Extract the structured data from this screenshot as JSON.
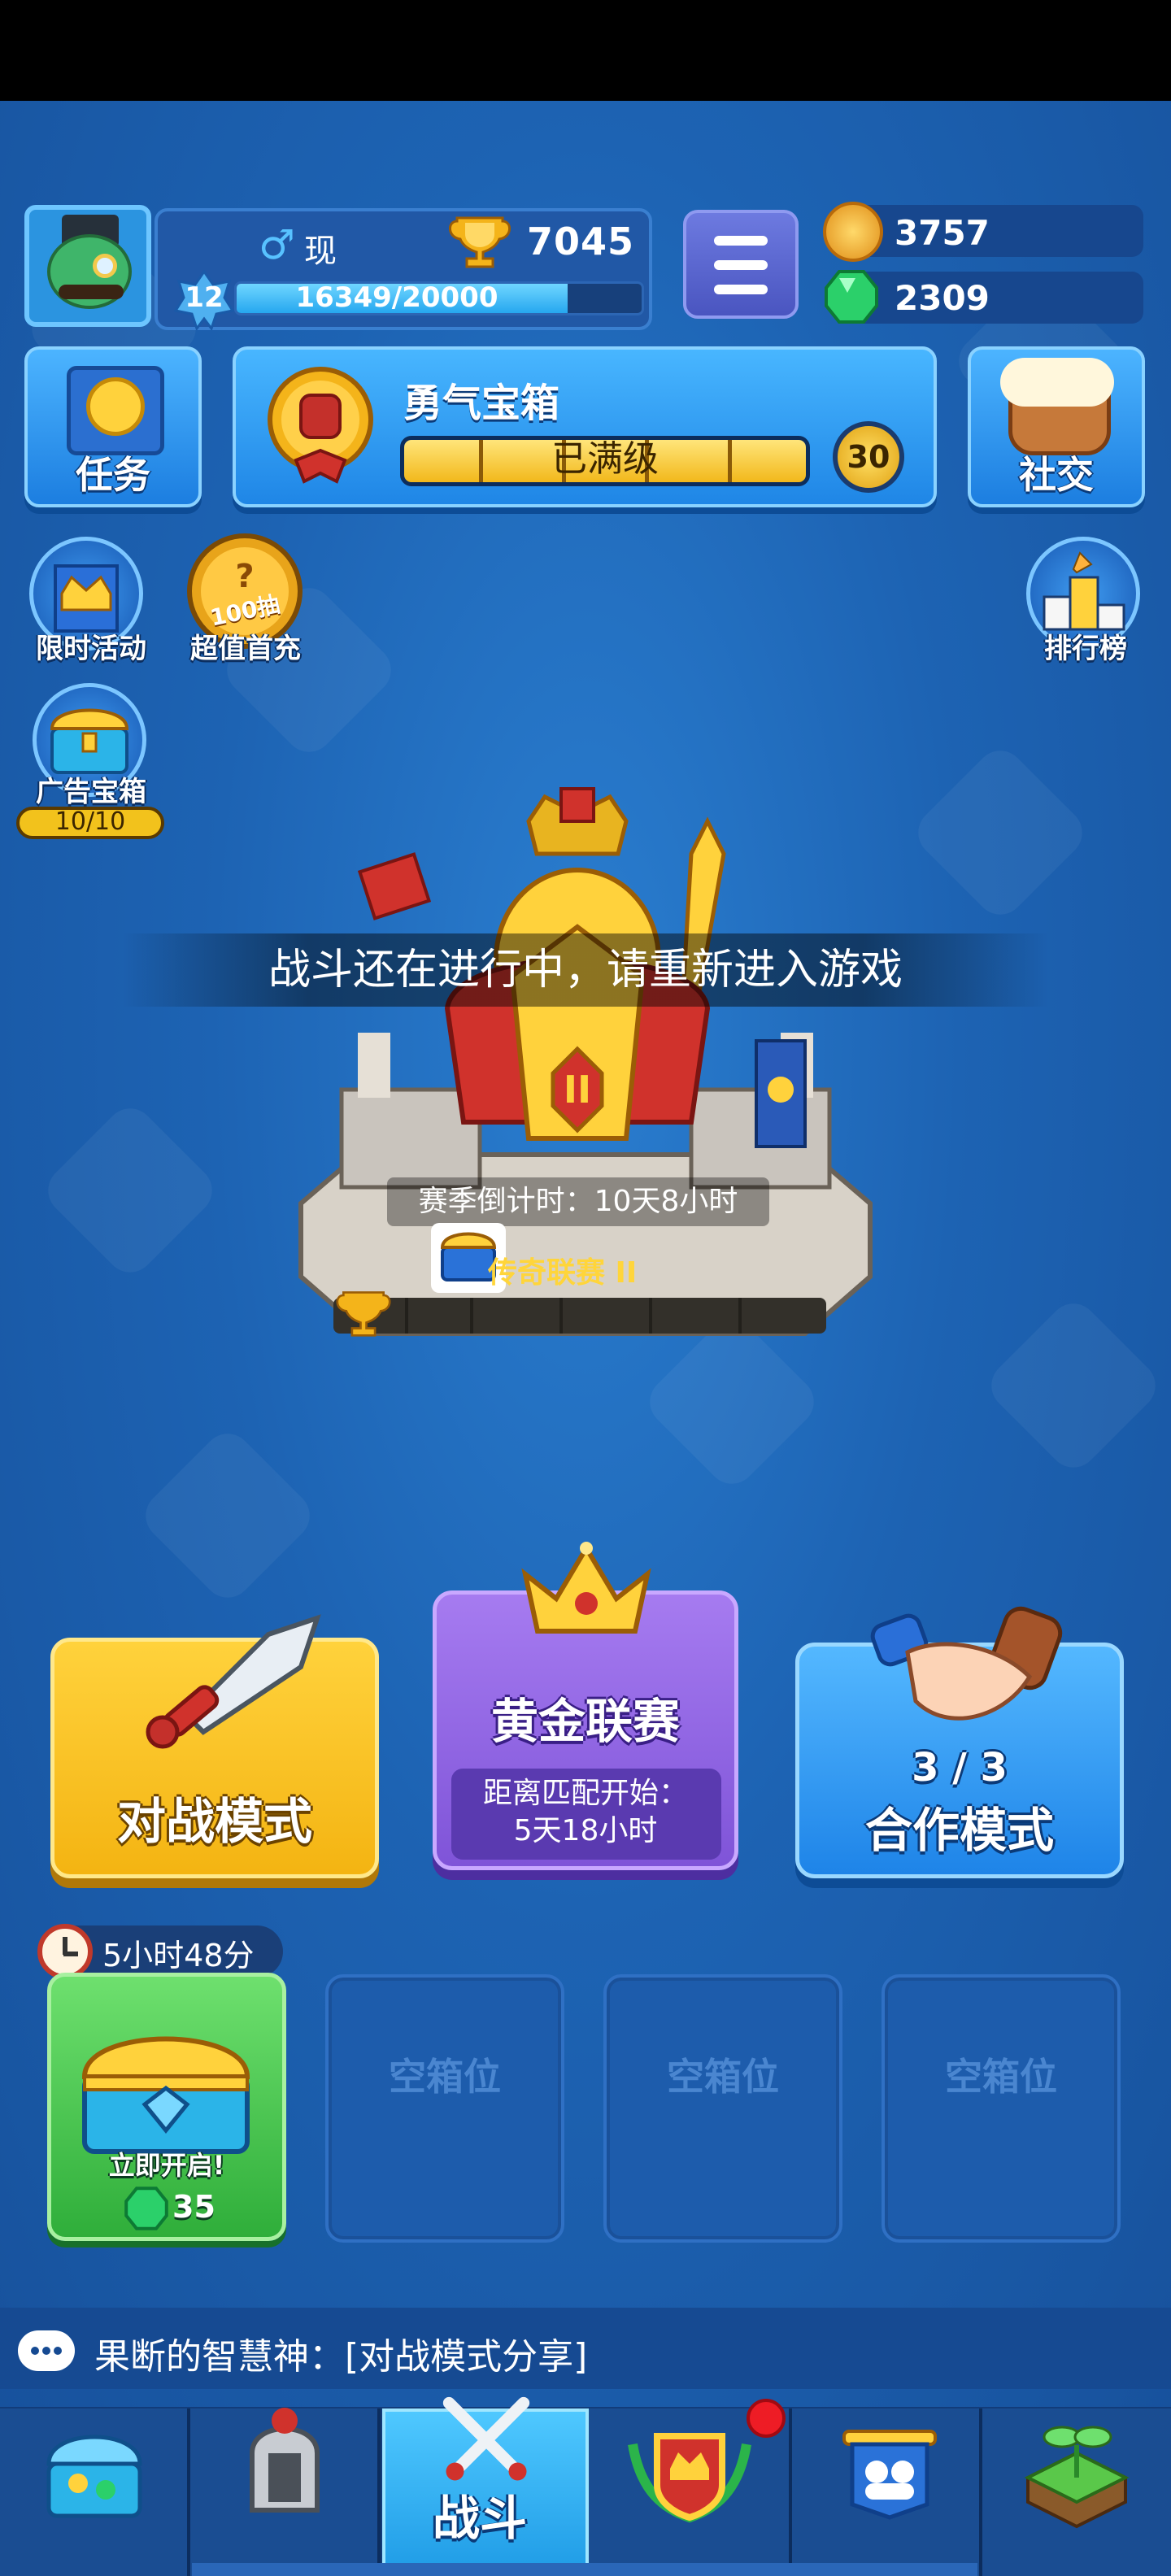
{
  "player": {
    "gender_symbol": "♂",
    "name": "现",
    "trophies": "7045",
    "level": "12",
    "xp_text": "16349/20000",
    "xp_fraction": 0.817
  },
  "currency": {
    "coins": "3757",
    "gems": "2309"
  },
  "top_buttons": {
    "tasks_label": "任务",
    "courage_chest_title": "勇气宝箱",
    "courage_status": "已满级",
    "courage_level": "30",
    "social_label": "社交"
  },
  "side_icons": {
    "limited_event": "限时活动",
    "first_recharge": "超值首充",
    "first_recharge_badge": "100抽",
    "ad_chest": "广告宝箱",
    "ad_chest_count": "10/10",
    "leaderboard": "排行榜"
  },
  "notice": "战斗还在进行中，请重新进入游戏",
  "league": {
    "countdown": "赛季倒计时：10天8小时",
    "name": "传奇联赛 II",
    "emblem_numeral": "II"
  },
  "modes": {
    "battle_label": "对战模式",
    "gold_league_label": "黄金联赛",
    "gold_league_sub1": "距离匹配开始：",
    "gold_league_sub2": "5天18小时",
    "coop_count": "3 / 3",
    "coop_label": "合作模式"
  },
  "chests": {
    "timer": "5小时48分",
    "open_now": "立即开启!",
    "gem_cost": "35",
    "empty_slots": [
      "空箱位",
      "空箱位",
      "空箱位"
    ]
  },
  "chat": {
    "message": "果断的智慧神：[对战模式分享]"
  },
  "nav": {
    "active_label": "战斗",
    "icons": [
      "chest-shop-icon",
      "knight-helmet-icon",
      "crossed-swords-icon",
      "crown-shield-icon",
      "team-banner-icon",
      "sprout-island-icon"
    ]
  },
  "colors": {
    "background": "#1f64b4",
    "battle_yellow": "#f4b412",
    "gold_league_purple": "#7f54d8",
    "coop_blue": "#1e84e8",
    "chest_green": "#2fae3a"
  }
}
